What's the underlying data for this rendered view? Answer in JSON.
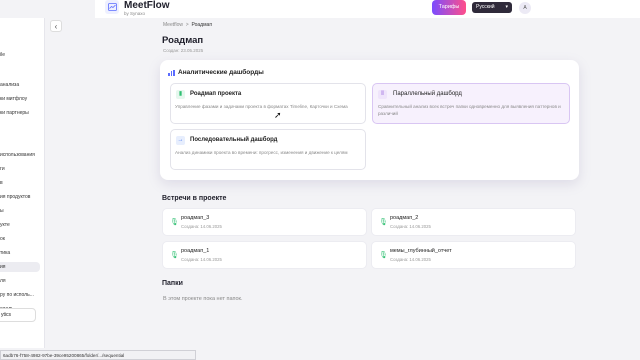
{
  "app": {
    "title": "MeetFlow",
    "subtitle": "by Synaxo",
    "logo_icon": "chart-logo-icon"
  },
  "header": {
    "tariffs_label": "Тарифы",
    "language": "Русский",
    "avatar_initial": "А"
  },
  "sidebar": {
    "collapse_icon": "‹",
    "items": [
      {
        "label": "ile",
        "active": false
      },
      {
        "label": "анализа",
        "active": false
      },
      {
        "label": "ки митфлоу",
        "active": false
      },
      {
        "label": "ки партнеры",
        "active": false
      },
      {
        "label": "использования",
        "active": false
      },
      {
        "label": "ги",
        "active": false
      },
      {
        "label": "в",
        "active": false
      },
      {
        "label": "ия продуктов",
        "active": false
      },
      {
        "label": "ы",
        "active": false
      },
      {
        "label": "укте",
        "active": false
      },
      {
        "label": "ок",
        "active": false
      },
      {
        "label": "тика",
        "active": false
      },
      {
        "label": "ия",
        "active": false
      },
      {
        "label": "ля",
        "active": true
      },
      {
        "label": "ру по исполь...",
        "active": false
      },
      {
        "label": "одель",
        "active": false
      }
    ],
    "analytics_button": "ytics"
  },
  "breadcrumb": {
    "root": "Meetflow",
    "separator": ">",
    "current": "Роадмап"
  },
  "page": {
    "title": "Роадмап",
    "created": "Создан: 23.05.2025"
  },
  "dashboards": {
    "title": "Аналитические дашборды",
    "cards": [
      {
        "title": "Роадмап проекта",
        "description": "Управление фазами и задачами проекта в форматах Timeline, Карточки и Схема",
        "icon": "book-icon",
        "icon_color": "#2fbf71",
        "highlighted": false
      },
      {
        "title": "Параллельный дашборд",
        "description": "Сравнительный анализ всех встреч папки одновременно для выявления паттернов и различий",
        "icon": "columns-icon",
        "icon_color": "#9b6bdf",
        "highlighted": true
      },
      {
        "title": "Последовательный дашборд",
        "description": "Анализ динамики проекта во времени: прогресс, изменения и движение к целям",
        "icon": "arrow-right-icon",
        "icon_color": "#4a7bf0",
        "highlighted": false
      }
    ]
  },
  "meetings": {
    "title": "Встречи в проекте",
    "items": [
      {
        "name": "роадмап_3",
        "date": "Создана: 14.06.2025"
      },
      {
        "name": "роадмап_2",
        "date": "Создана: 14.06.2025"
      },
      {
        "name": "роадмап_1",
        "date": "Создана: 14.06.2025"
      },
      {
        "name": "мемы_глубинный_отчет",
        "date": "Создана: 14.06.2025"
      }
    ]
  },
  "folders": {
    "title": "Папки",
    "empty_text": "В этом проекте пока нет папок."
  },
  "statusbar": {
    "url": "6adb76-f758-4982-97be-39ce95200865/folder/.../sequential"
  },
  "colors": {
    "accent": "#5b6cff",
    "tariffs_gradient_start": "#7b4dff",
    "tariffs_gradient_end": "#ff4e8a",
    "meeting_icon": "#2fbf71"
  }
}
